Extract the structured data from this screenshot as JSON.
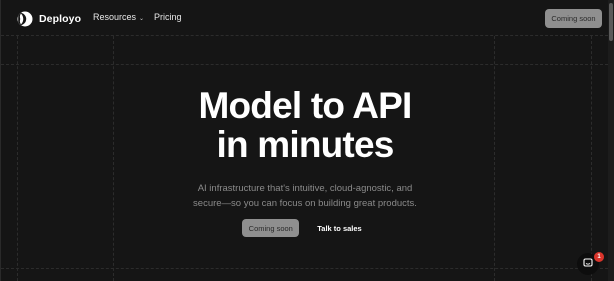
{
  "nav": {
    "brand": "Deployo",
    "resources_label": "Resources",
    "pricing_label": "Pricing",
    "cta_label": "Coming soon"
  },
  "hero": {
    "title_line1": "Model to API",
    "title_line2": "in minutes",
    "subtitle_line1": "AI infrastructure that's intuitive, cloud-agnostic, and",
    "subtitle_line2": "secure—so you can focus on building great products.",
    "primary_label": "Coming soon",
    "secondary_label": "Talk to sales"
  },
  "chat": {
    "badge_count": "1"
  },
  "colors": {
    "background": "#151515",
    "button_bg": "#8f8f8f",
    "badge": "#d9342b"
  }
}
